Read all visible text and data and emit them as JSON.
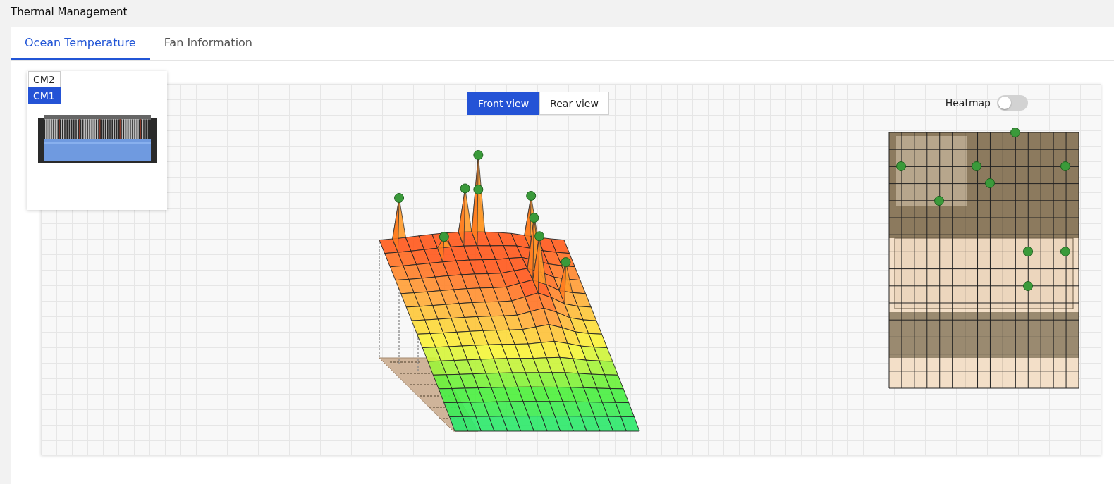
{
  "window": {
    "title": "Thermal Management"
  },
  "tabs": [
    {
      "label": "Ocean Temperature",
      "selected": true
    },
    {
      "label": "Fan Information",
      "selected": false
    }
  ],
  "module_selector": [
    {
      "label": "CM2",
      "selected": false
    },
    {
      "label": "CM1",
      "selected": true
    }
  ],
  "view_buttons": [
    {
      "label": "Front view",
      "selected": true
    },
    {
      "label": "Rear view",
      "selected": false
    }
  ],
  "heatmap": {
    "label": "Heatmap",
    "on": false
  }
}
